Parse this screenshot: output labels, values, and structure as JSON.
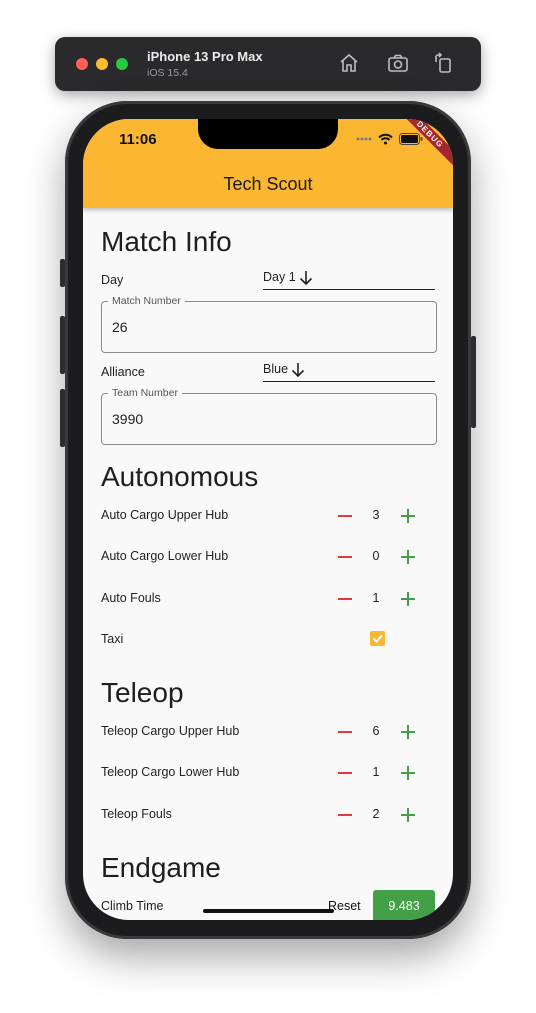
{
  "simulator": {
    "device": "iPhone 13 Pro Max",
    "os": "iOS 15.4"
  },
  "status_bar": {
    "time": "11:06"
  },
  "app": {
    "title": "Tech Scout",
    "debug_banner": "DEBUG",
    "accent": "#fbb731"
  },
  "match_info": {
    "heading": "Match Info",
    "day_label": "Day",
    "day_value": "Day 1",
    "match_number_label": "Match Number",
    "match_number_value": "26",
    "alliance_label": "Alliance",
    "alliance_value": "Blue",
    "team_number_label": "Team Number",
    "team_number_value": "3990"
  },
  "autonomous": {
    "heading": "Autonomous",
    "rows": [
      {
        "label": "Auto Cargo Upper Hub",
        "value": "3"
      },
      {
        "label": "Auto Cargo Lower Hub",
        "value": "0"
      },
      {
        "label": "Auto Fouls",
        "value": "1"
      }
    ],
    "taxi_label": "Taxi",
    "taxi_checked": true
  },
  "teleop": {
    "heading": "Teleop",
    "rows": [
      {
        "label": "Teleop Cargo Upper Hub",
        "value": "6"
      },
      {
        "label": "Teleop Cargo Lower Hub",
        "value": "1"
      },
      {
        "label": "Teleop Fouls",
        "value": "2"
      }
    ]
  },
  "endgame": {
    "heading": "Endgame",
    "climb_time_label": "Climb Time",
    "reset_label": "Reset",
    "timer_value": "9.483"
  },
  "colors": {
    "minus": "#e53935",
    "plus": "#43a047",
    "timer_bg": "#43a047"
  }
}
